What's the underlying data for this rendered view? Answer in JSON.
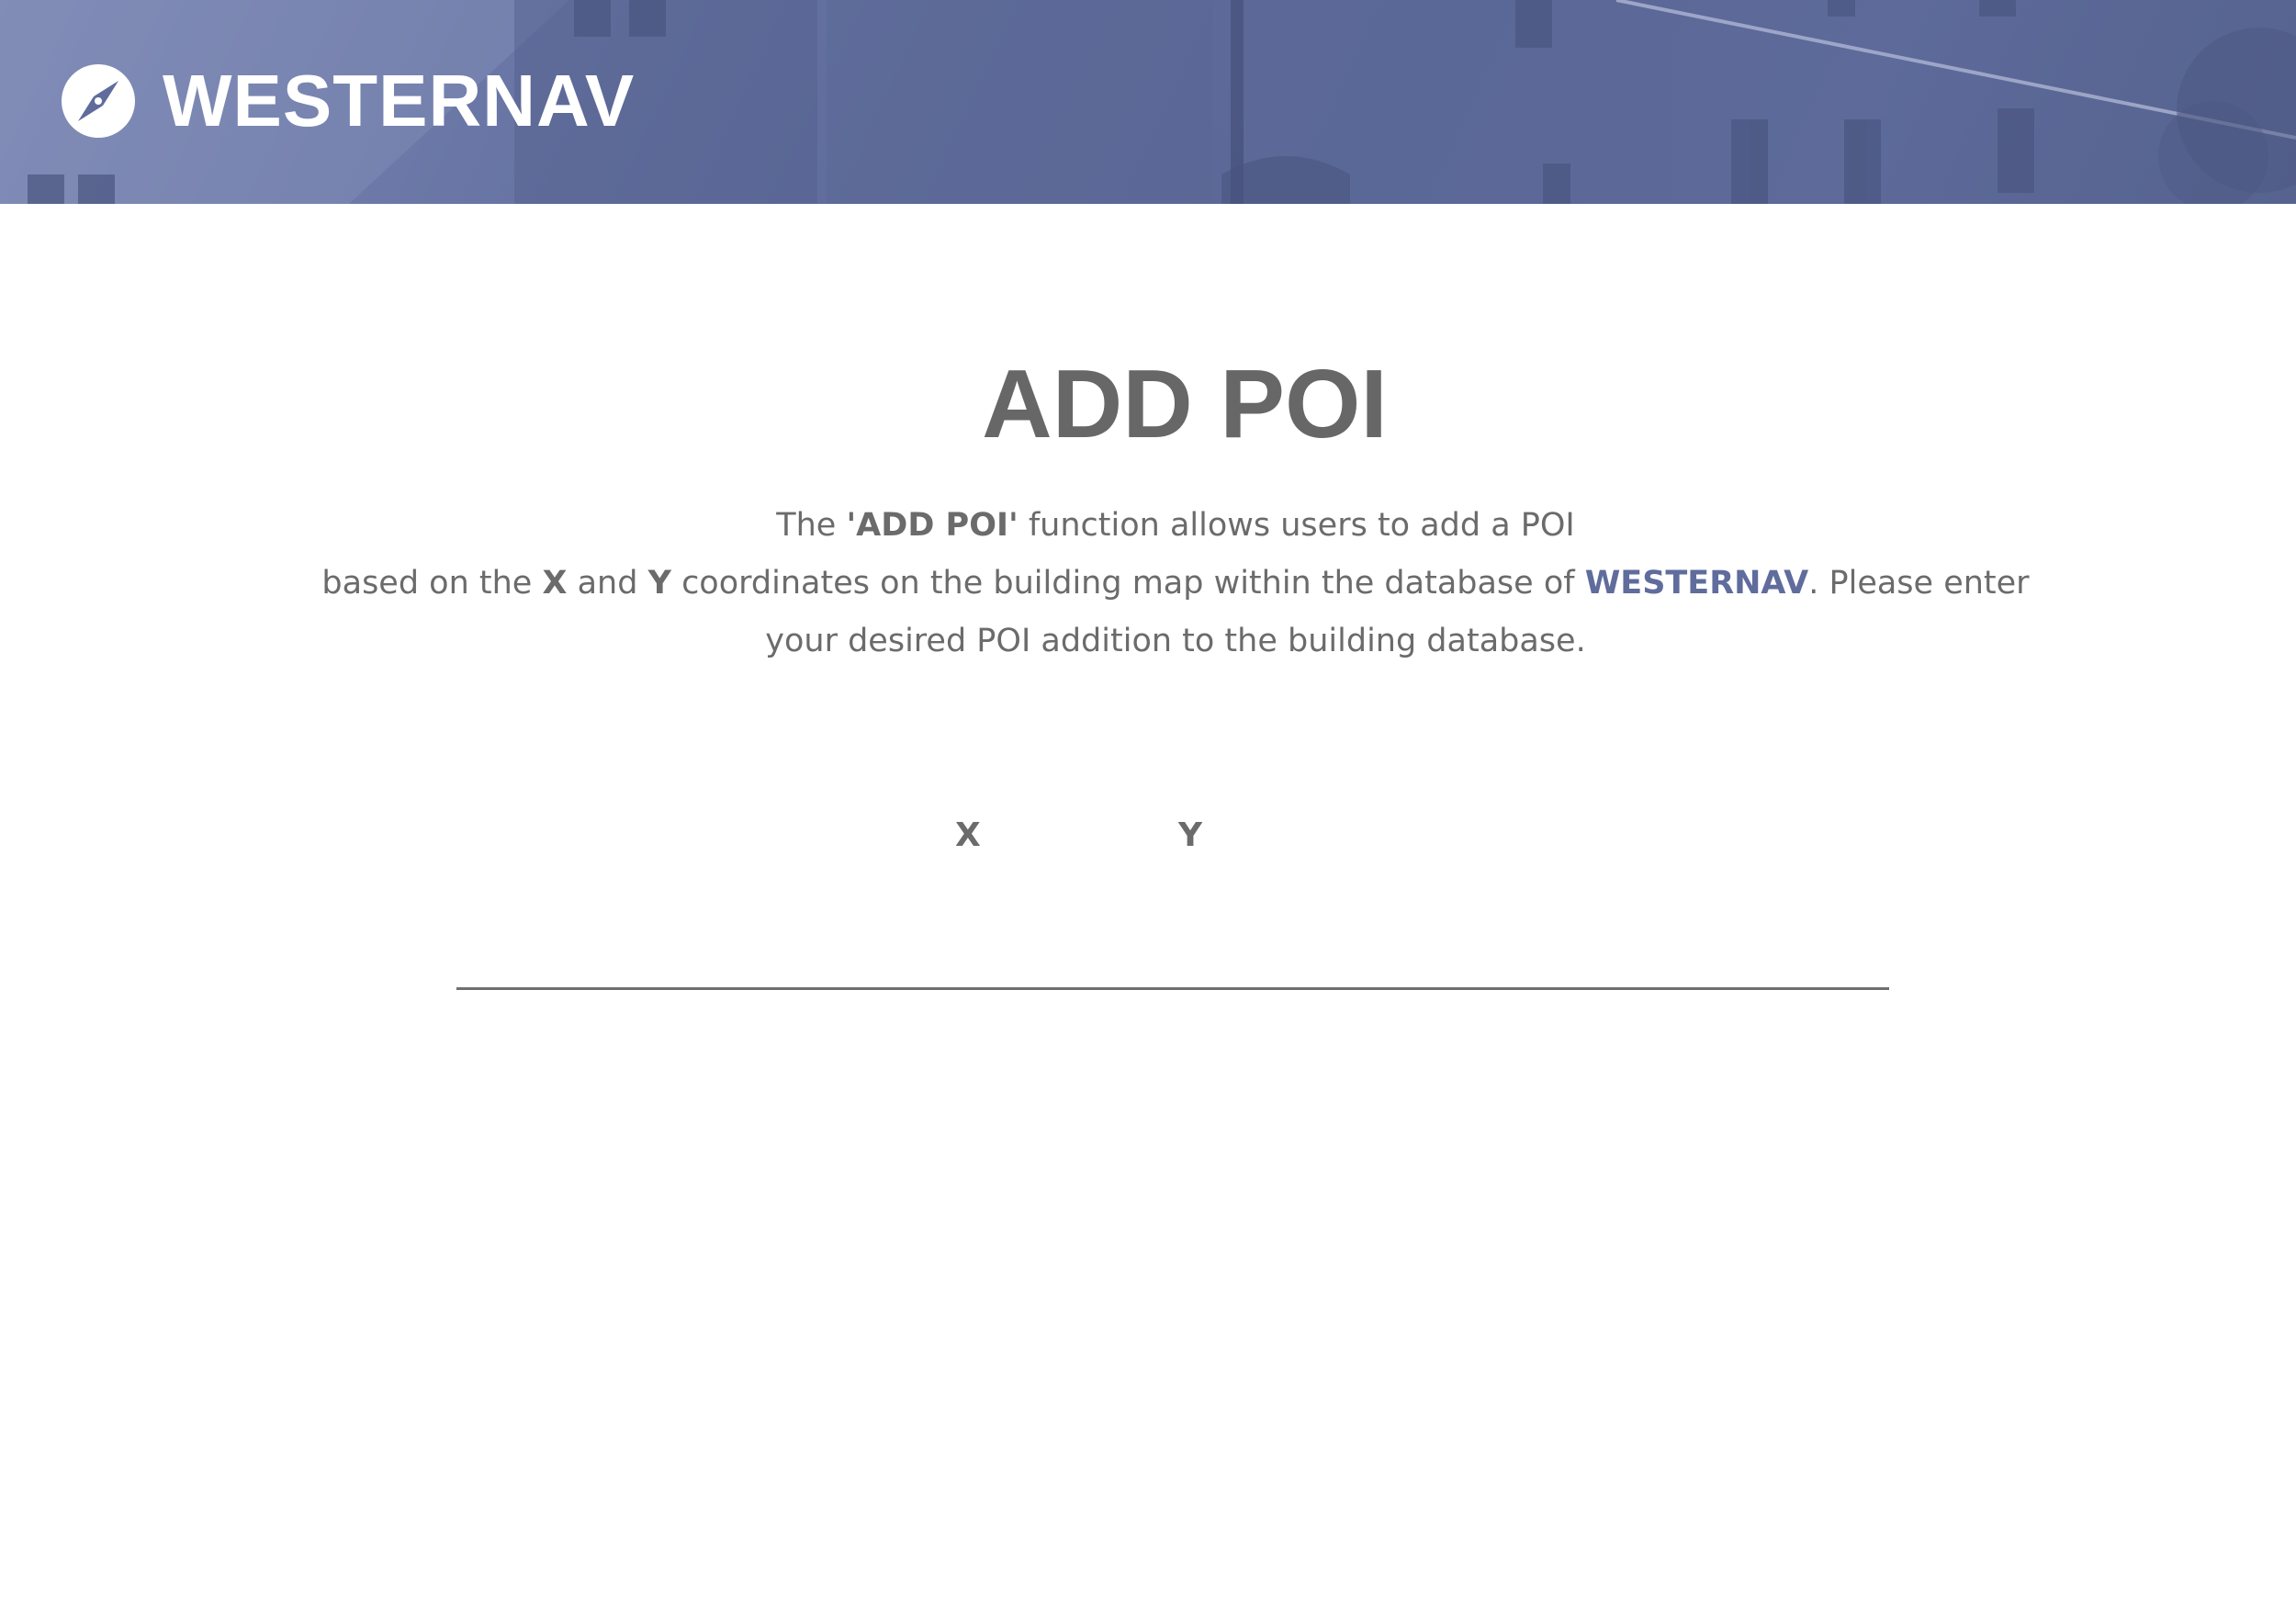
{
  "header": {
    "brand_name": "WESTERNAV",
    "logo_icon": "compass-icon",
    "background_color": "#5f6c9c"
  },
  "main": {
    "title": "ADD POI",
    "description": {
      "line1_pre": "The ",
      "line1_bold": "'ADD POI'",
      "line1_post": " function allows users to add a POI",
      "line2_pre": "based on the ",
      "line2_x": "X",
      "line2_and": " and ",
      "line2_y": "Y",
      "line2_mid": " coordinates on the building map within the database of ",
      "line2_brand": "WESTERNAV",
      "line2_post": ". Please enter",
      "line3": "your desired POI addition to the building database."
    },
    "coords": {
      "x_label": "X",
      "y_label": "Y"
    }
  },
  "colors": {
    "text_gray": "#676767",
    "brand_blue": "#5f6c9c",
    "white": "#ffffff"
  }
}
